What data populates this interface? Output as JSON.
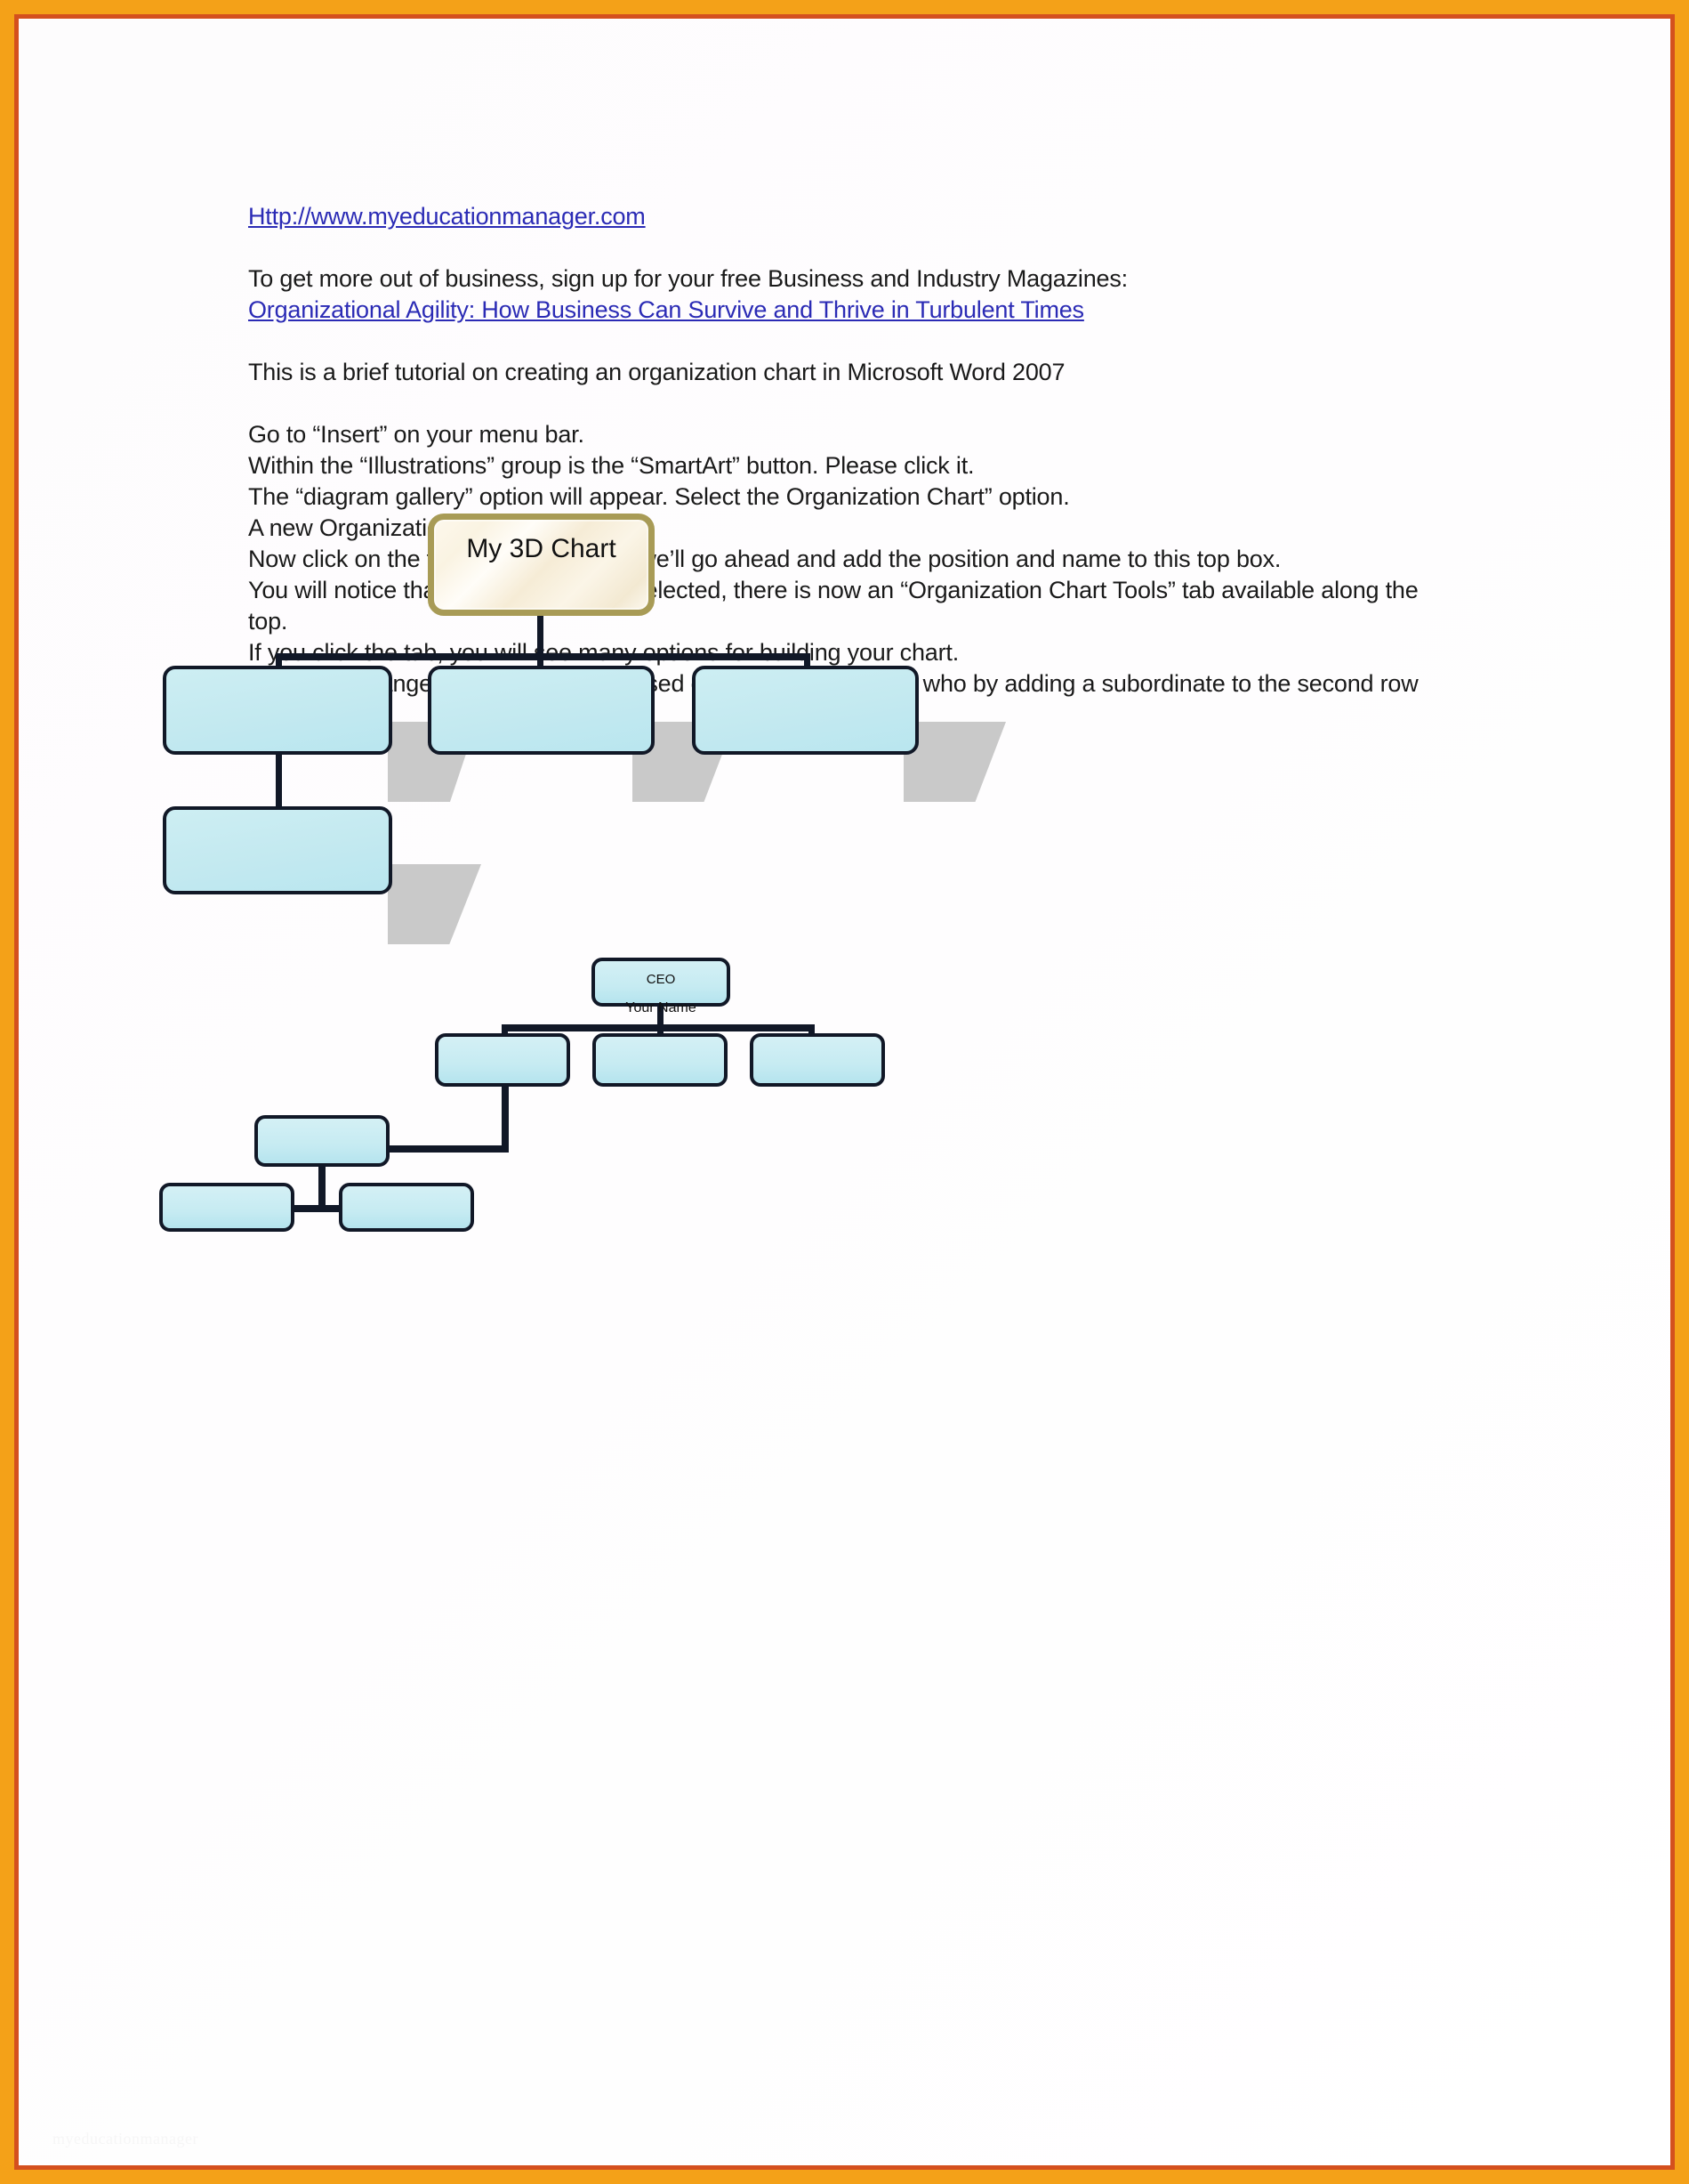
{
  "page": {
    "border_outer_color": "#f4a118",
    "border_inner_color": "#d4501e",
    "background_color": "#ffffff",
    "watermark_text": "myeducationmanager"
  },
  "document": {
    "site_link": "Http://www.myeducationmanager.com",
    "intro_line": "To get more out of business, sign up for your free Business and Industry Magazines:",
    "magazine_link": "Organizational Agility: How Business Can Survive and Thrive in Turbulent Times",
    "tutorial_line": "This is a brief tutorial on creating an organization chart in Microsoft Word 2007",
    "steps": [
      "Go to “Insert” on your menu bar.",
      "Within the “Illustrations” group is the “SmartArt” button. Please click it.",
      "The “diagram gallery” option will appear. Select the Organization Chart” option.",
      "A new Organization Chart will appear.",
      "Now click on the top box. At this time we’ll go ahead and add the position and name to this top box.",
      "You will notice that since the chart is selected, there is now an “Organization Chart Tools” tab available along the top.",
      "If you click the tab, you will see many options for building your chart.",
      "Now we’ll change the configuration based on who is reporting to who by adding a subordinate to the second row left box."
    ],
    "link_color": "#2b2bb5",
    "text_color": "#1a1a1a"
  },
  "chart_one": {
    "name": "my-3d-chart-org-chart",
    "style": "3D with drop shadows",
    "root": {
      "label": "My 3D Chart",
      "fill": "#faf3e2",
      "border": "#a89b56"
    },
    "node_fill": "#c6ebf2",
    "node_border": "#111827",
    "shadow_color": "#c9c9c9",
    "level_two": [
      {
        "label": ""
      },
      {
        "label": ""
      },
      {
        "label": ""
      }
    ],
    "level_three": [
      {
        "label": "",
        "parent_index": 0
      }
    ]
  },
  "chart_two": {
    "name": "ceo-org-chart",
    "style": "flat with hanging subordinate",
    "node_fill": "#c6ebf2",
    "node_border": "#111827",
    "root": {
      "title": "CEO",
      "name": "Your Name"
    },
    "level_two": [
      {
        "label": ""
      },
      {
        "label": ""
      },
      {
        "label": ""
      }
    ],
    "hanging": {
      "label": "",
      "parent_index": 0
    },
    "level_four": [
      {
        "label": ""
      },
      {
        "label": ""
      }
    ]
  },
  "chart_data": {
    "type": "diagram",
    "diagram_kind": "organization-chart",
    "charts": [
      {
        "title": "My 3D Chart",
        "nodes": [
          {
            "id": "root",
            "label": "My 3D Chart",
            "level": 0,
            "parent": null
          },
          {
            "id": "a1",
            "label": "",
            "level": 1,
            "parent": "root"
          },
          {
            "id": "a2",
            "label": "",
            "level": 1,
            "parent": "root"
          },
          {
            "id": "a3",
            "label": "",
            "level": 1,
            "parent": "root"
          },
          {
            "id": "b1",
            "label": "",
            "level": 2,
            "parent": "a1"
          }
        ]
      },
      {
        "title": "CEO / Your Name",
        "nodes": [
          {
            "id": "ceo",
            "label": "CEO\nYour Name",
            "level": 0,
            "parent": null
          },
          {
            "id": "d1",
            "label": "",
            "level": 1,
            "parent": "ceo"
          },
          {
            "id": "d2",
            "label": "",
            "level": 1,
            "parent": "ceo"
          },
          {
            "id": "d3",
            "label": "",
            "level": 1,
            "parent": "ceo"
          },
          {
            "id": "e1",
            "label": "",
            "level": 2,
            "parent": "d1",
            "layout": "hanging-left"
          },
          {
            "id": "f1",
            "label": "",
            "level": 3,
            "parent": "e1"
          },
          {
            "id": "f2",
            "label": "",
            "level": 3,
            "parent": "e1"
          }
        ]
      }
    ]
  }
}
